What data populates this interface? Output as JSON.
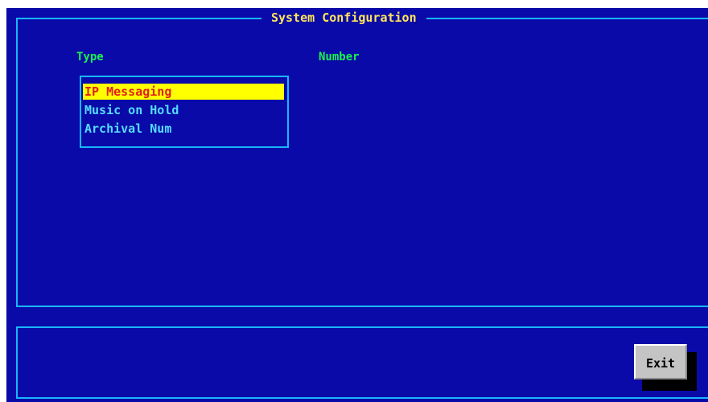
{
  "window": {
    "title": "System Configuration"
  },
  "columns": {
    "type_label": "Type",
    "number_label": "Number"
  },
  "type_list": {
    "selected_index": 0,
    "items": [
      {
        "label": "IP Messaging"
      },
      {
        "label": "Music on Hold"
      },
      {
        "label": "Archival Num"
      }
    ]
  },
  "footer": {
    "exit_label": "Exit"
  },
  "colors": {
    "background": "#0a0aa8",
    "frame_border": "#19b6ff",
    "title_text": "#ffe45a",
    "header_text": "#17f54a",
    "list_text": "#55dcff",
    "selection_background": "#ffff00",
    "selection_text": "#e0201a",
    "button_face": "#c4c4c4"
  }
}
